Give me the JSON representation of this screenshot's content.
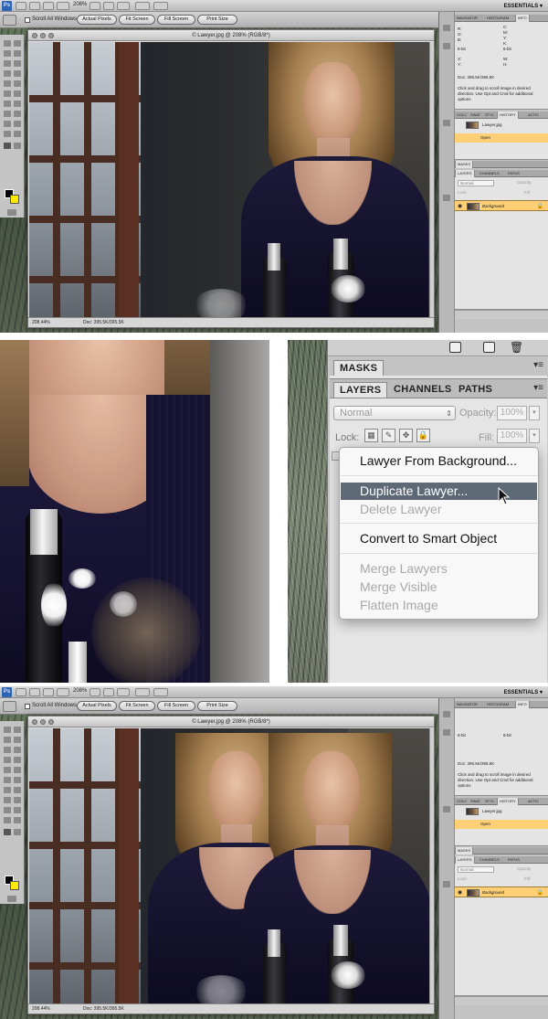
{
  "top": {
    "zoom_menu": "208%",
    "essentials": "ESSENTIALS ▾",
    "options": {
      "scroll_all_windows": "Scroll All Windows",
      "actual_pixels": "Actual Pixels",
      "fit_screen": "Fit Screen",
      "fill_screen": "Fill Screen",
      "print_size": "Print Size"
    },
    "doc": {
      "title": "© Lawyer.jpg @ 208% (RGB/8*)",
      "zoom": "208.44%",
      "status": "Doc: 395.5K/395.5K"
    },
    "panels": {
      "info_tabs": [
        "NAVIGATOR",
        "HISTOGRAM",
        "INFO"
      ],
      "info_r": "R:",
      "info_g": "G:",
      "info_b": "B:",
      "info_c": "C:",
      "info_m": "M:",
      "info_y": "Y:",
      "info_k": "K:",
      "info_8bit_a": "8-bit",
      "info_8bit_b": "8-bit",
      "info_x": "X:",
      "info_yy": "Y:",
      "info_w": "W:",
      "info_h": "H:",
      "info_doc": "Doc: 395.5K/395.5K",
      "info_hint": "Click and drag to scroll image in desired direction. Use Opt and Cmd for additional options",
      "history_tabs": [
        "COLC",
        "SWAT",
        "STYL",
        "HISTORY",
        "ACTIC"
      ],
      "history_file": "Lawyer.jpg",
      "history_open": "Open",
      "masks_tab": "MASKS",
      "layers_tabs": [
        "LAYERS",
        "CHANNELS",
        "PATHS"
      ],
      "blend_mode": "Normal",
      "opacity_label": "Opacity:",
      "lock_label": "Lock:",
      "fill_label": "Fill:",
      "layer_name": "Background"
    }
  },
  "middle": {
    "masks_tab": "MASKS",
    "tabs": [
      "LAYERS",
      "CHANNELS",
      "PATHS"
    ],
    "blend_mode": "Normal",
    "opacity_label": "Opacity:",
    "opacity_value": "100%",
    "lock_label": "Lock:",
    "fill_label": "Fill:",
    "fill_value": "100%",
    "context_menu": [
      {
        "label": "Lawyer From Background...",
        "state": "enabled"
      },
      {
        "label": "Duplicate Lawyer...",
        "state": "highlighted"
      },
      {
        "label": "Delete Lawyer",
        "state": "disabled"
      },
      {
        "label": "Convert to Smart Object",
        "state": "enabled"
      },
      {
        "label": "Merge Lawyers",
        "state": "disabled"
      },
      {
        "label": "Merge Visible",
        "state": "disabled"
      },
      {
        "label": "Flatten Image",
        "state": "disabled"
      }
    ]
  },
  "bottom": {
    "zoom_menu": "208%",
    "essentials": "ESSENTIALS ▾",
    "options": {
      "scroll_all_windows": "Scroll All Windows",
      "actual_pixels": "Actual Pixels",
      "fit_screen": "Fit Screen",
      "fill_screen": "Fill Screen",
      "print_size": "Print Size"
    },
    "doc": {
      "title": "© Lawyer.jpg @ 208% (RGB/8*)",
      "zoom": "208.44%",
      "status": "Doc: 395.5K/395.5K"
    },
    "panels": {
      "info_tabs": [
        "NAVIGATOR",
        "HISTOGRAM",
        "INFO"
      ],
      "info_8bit_a": "8-bit",
      "info_8bit_b": "8-bit",
      "info_doc": "Doc: 395.5K/395.5K",
      "info_hint": "Click and drag to scroll image in desired direction. Use Opt and Cmd for additional options",
      "history_tabs": [
        "COLC",
        "SWAT",
        "STYL",
        "HISTORY",
        "ACTIC"
      ],
      "history_file": "Lawyer.jpg",
      "history_open": "Open",
      "masks_tab": "MASKS",
      "layers_tabs": [
        "LAYERS",
        "CHANNELS",
        "PATHS"
      ],
      "blend_mode": "Normal",
      "opacity_label": "Opacity:",
      "lock_label": "Lock:",
      "fill_label": "Fill:",
      "layer_name": "Background"
    }
  },
  "colors": {
    "menu_highlight": "#5d6a76",
    "layer_selected": "#ffcf76",
    "foreground_color": "#000000",
    "background_color": "#ffea00",
    "ps_logo": "#2f63b3"
  }
}
